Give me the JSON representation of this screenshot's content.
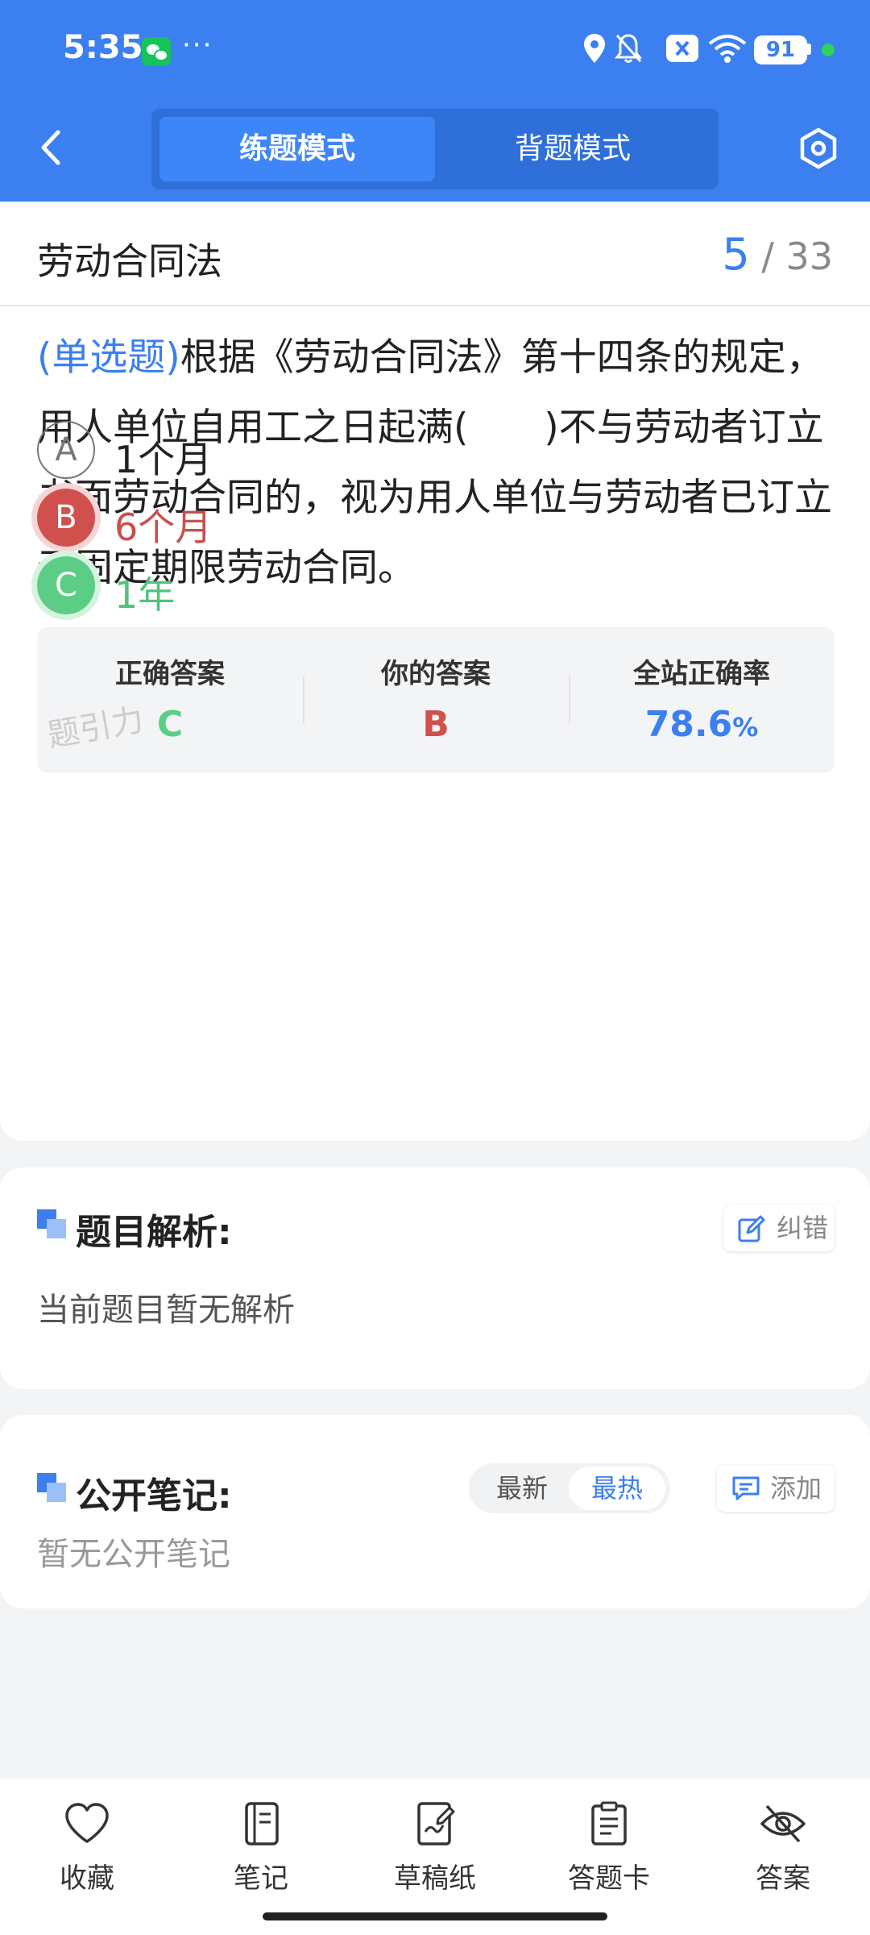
{
  "status_bar": {
    "time": "5:35",
    "more": "···",
    "battery": "91"
  },
  "header": {
    "modes": [
      "练题模式",
      "背题模式"
    ],
    "active_mode": "练题模式"
  },
  "question_header": {
    "subject": "劳动合同法",
    "current": "5",
    "separator": "/",
    "total": "33"
  },
  "question": {
    "type_label": "(单选题)",
    "text": "根据《劳动合同法》第十四条的规定，用人单位自用工之日起满(　　)不与劳动者订立书面劳动合同的，视为用人单位与劳动者已订立无固定期限劳动合同。",
    "options": [
      {
        "letter": "A",
        "text": "1个月",
        "state": "normal"
      },
      {
        "letter": "B",
        "text": "6个月",
        "state": "wrong"
      },
      {
        "letter": "C",
        "text": "1年",
        "state": "correct"
      }
    ]
  },
  "answer_summary": {
    "correct_label": "正确答案",
    "correct_value": "C",
    "yours_label": "你的答案",
    "yours_value": "B",
    "rate_label": "全站正确率",
    "rate_value": "78.6",
    "rate_unit": "%",
    "watermark": "题引力"
  },
  "analysis": {
    "title": "题目解析:",
    "report_label": "纠错",
    "body": "当前题目暂无解析"
  },
  "notes": {
    "title": "公开笔记:",
    "sort_options": [
      "最新",
      "最热"
    ],
    "active_sort": "最热",
    "add_label": "添加",
    "body": "暂无公开笔记"
  },
  "bottom_nav": {
    "items": [
      {
        "label": "收藏",
        "icon": "heart-icon"
      },
      {
        "label": "笔记",
        "icon": "notebook-icon"
      },
      {
        "label": "草稿纸",
        "icon": "draft-icon"
      },
      {
        "label": "答题卡",
        "icon": "clipboard-icon"
      },
      {
        "label": "答案",
        "icon": "eye-off-icon"
      }
    ]
  },
  "colors": {
    "primary": "#3b7ff0",
    "wrong": "#d0504d",
    "correct": "#5ccd84"
  }
}
